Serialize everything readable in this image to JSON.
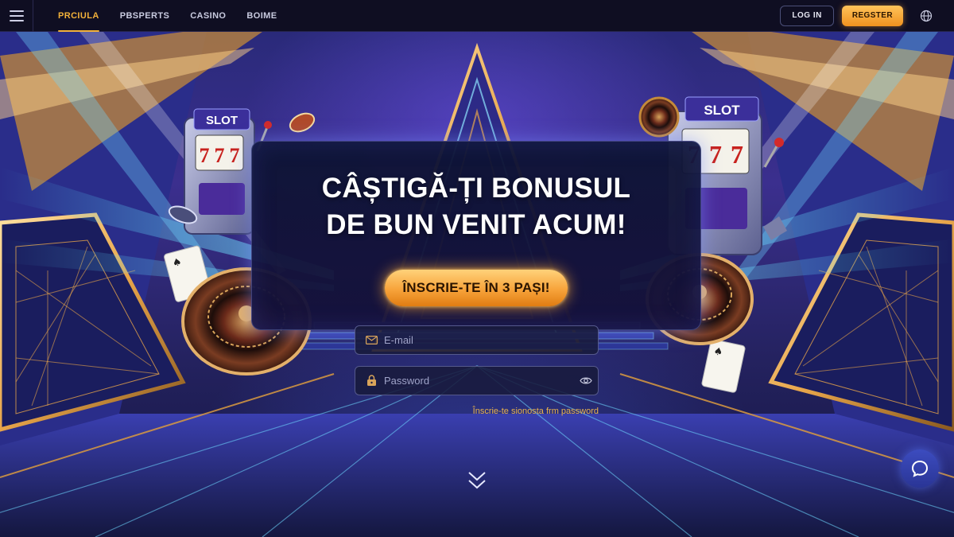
{
  "nav": {
    "items": [
      {
        "label": "PRCIULA",
        "active": true
      },
      {
        "label": "PBSPERTS",
        "active": false
      },
      {
        "label": "CASINO",
        "active": false
      },
      {
        "label": "BOIME",
        "active": false
      }
    ]
  },
  "header": {
    "login_label": "LOG IN",
    "register_label": "REGSTER",
    "language_icon": "globe-icon"
  },
  "hero": {
    "title_line1": "CÂȘTIGĂ-ȚI BONUSUL",
    "title_line2": "DE BUN VENIT ACUM!",
    "cta_label": "ÎNSCRIE-TE ÎN 3 PAȘI!",
    "slot_left_label": "SLOT",
    "slot_right_label": "SLOT",
    "reel_symbols": [
      "7",
      "7",
      "7"
    ]
  },
  "form": {
    "email_placeholder": "E-mail",
    "password_placeholder": "Password",
    "forgot_text": "Înscrie-te sionosta frm password"
  },
  "colors": {
    "accent": "#f2b13a",
    "header_bg": "#0f0e22",
    "cta_orange": "#f7a33a"
  },
  "icons": {
    "menu": "menu-icon",
    "email": "mail-icon",
    "password": "lock-icon",
    "reveal": "eye-icon",
    "scroll": "chevron-down-icon",
    "chat": "chat-icon"
  }
}
